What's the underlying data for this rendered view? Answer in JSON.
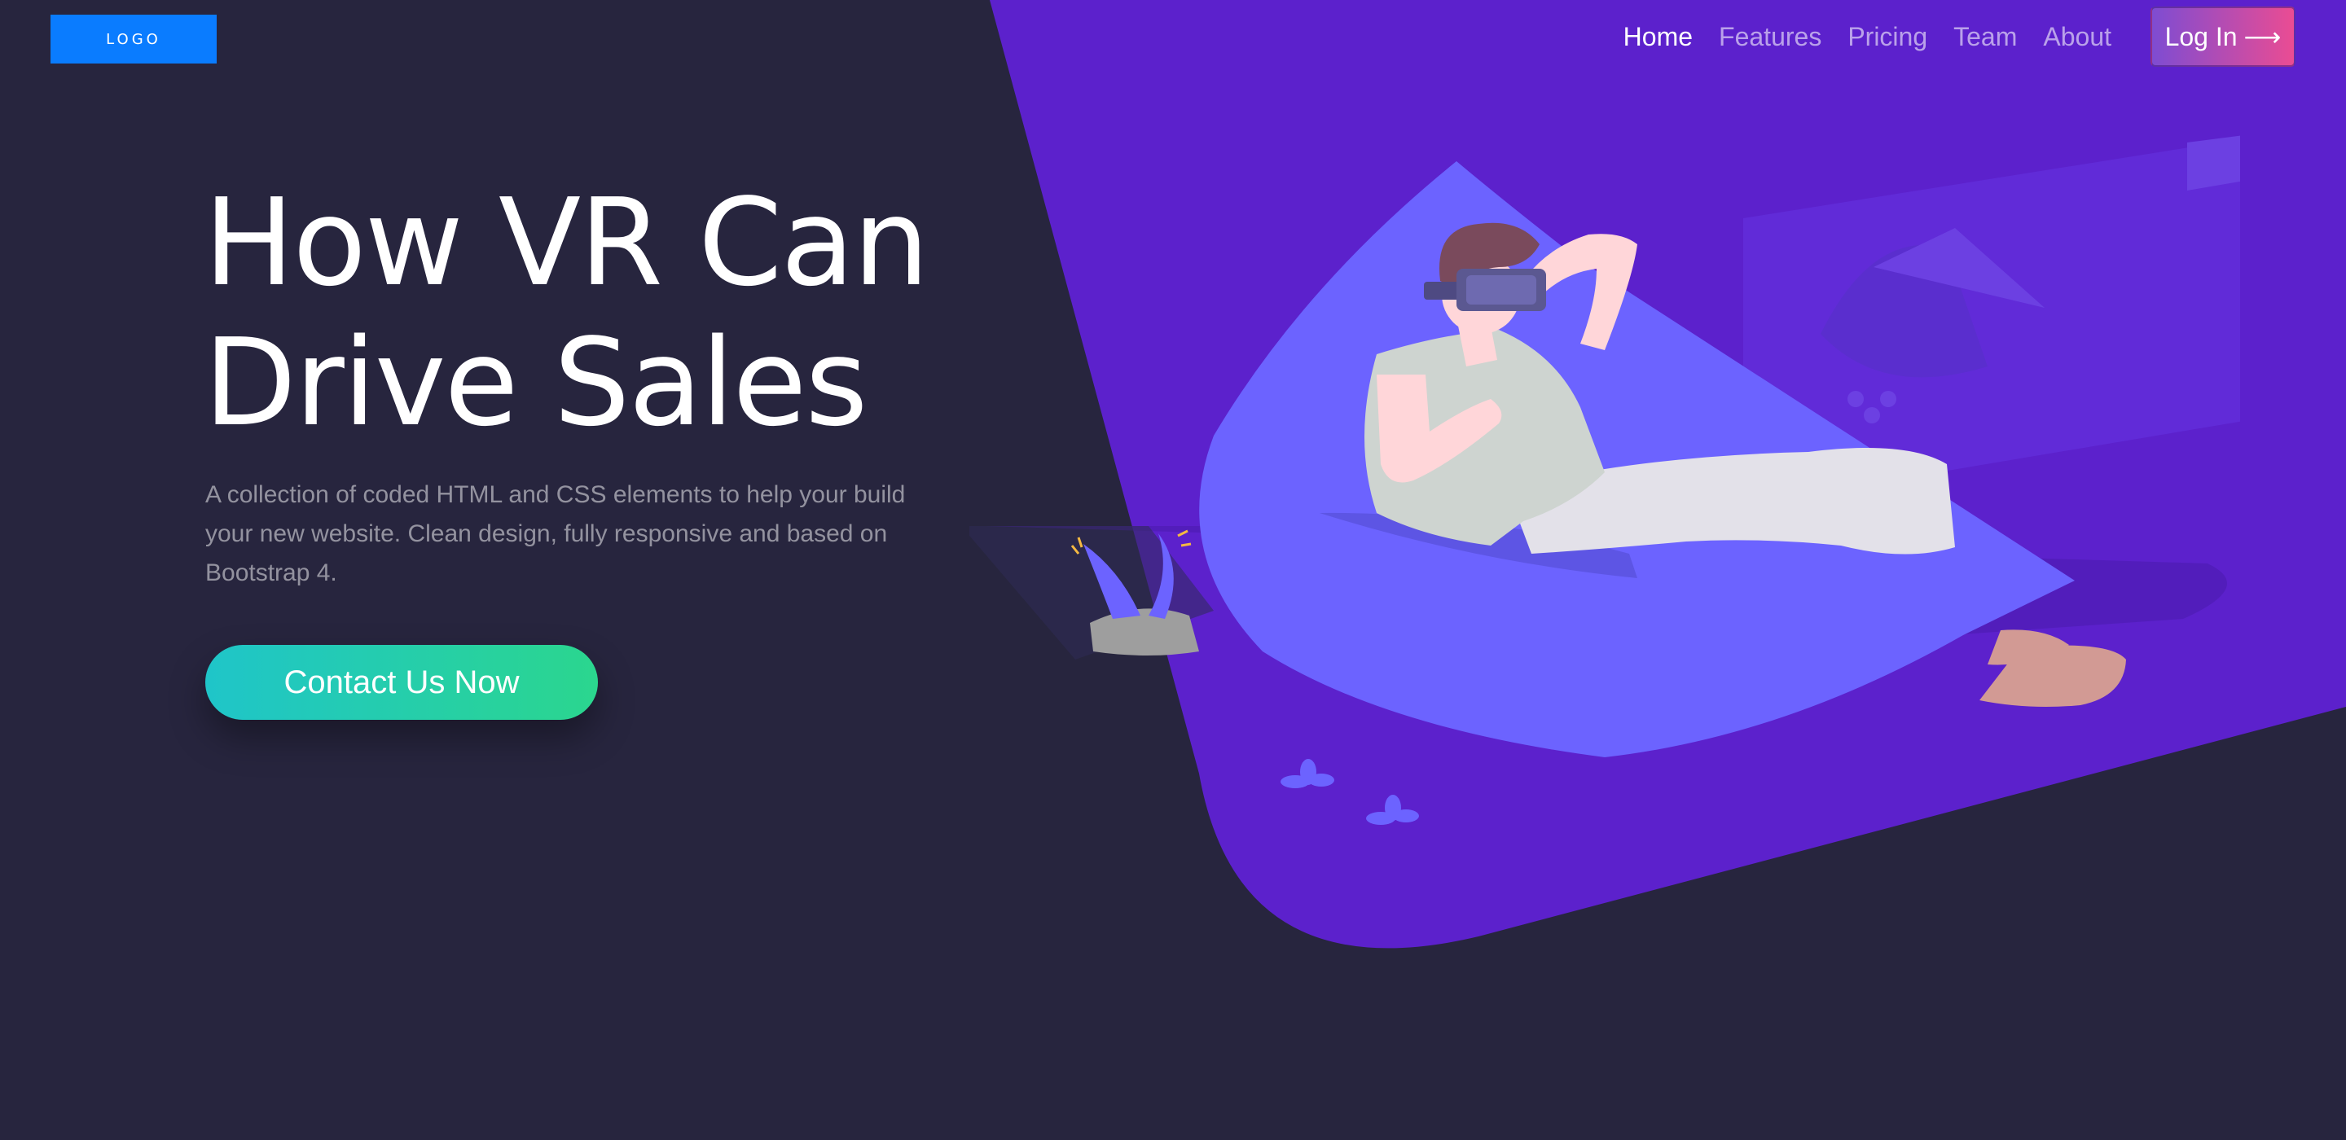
{
  "header": {
    "logo_text": "LOGO",
    "nav": [
      {
        "label": "Home",
        "active": true
      },
      {
        "label": "Features",
        "active": false
      },
      {
        "label": "Pricing",
        "active": false
      },
      {
        "label": "Team",
        "active": false
      },
      {
        "label": "About",
        "active": false
      }
    ],
    "login": {
      "label": "Log In",
      "icon": "arrow-right-icon",
      "arrow": "⟶"
    }
  },
  "hero": {
    "title_line1": "How VR Can",
    "title_line2": "Drive Sales",
    "description": "A collection of coded HTML and CSS elements to help your build your new website. Clean design, fully responsive and based on Bootstrap 4.",
    "cta_label": "Contact Us Now"
  },
  "colors": {
    "background": "#27253e",
    "hero_purple": "#5c21cc",
    "logo_blue": "#0a7cff",
    "login_gradient_start": "#7e4cd2",
    "login_gradient_end": "#ea4c93",
    "cta_gradient_start": "#1fc5c9",
    "cta_gradient_end": "#2bd68e"
  },
  "illustration": {
    "subject": "person-wearing-vr-headset-on-beanbag"
  }
}
